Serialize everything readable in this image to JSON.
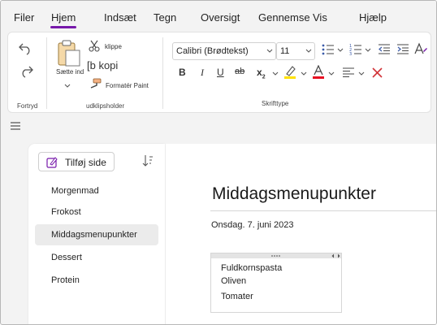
{
  "menu": {
    "items": [
      "Filer",
      "Hjem",
      "Indsæt",
      "Tegn",
      "Oversigt",
      "Gennemse",
      "Vis",
      "Hjælp"
    ],
    "active": "Hjem",
    "accent": "#7719aa"
  },
  "ribbon": {
    "undo_group": {
      "undo_icon": "undo-icon",
      "redo_icon": "redo-icon",
      "label": "Fortryd"
    },
    "clipboard": {
      "paste_label": "Sætte ind",
      "cut_label": "klippe",
      "copy_label": "[b kopi",
      "format_painter_label": "Formatér Paint",
      "label": "udklipsholder"
    },
    "font": {
      "font_name": "Calibri (Brødtekst)",
      "font_size": "11",
      "label": "Skrifttype",
      "highlight_color": "#ffe100",
      "font_color": "#e81123",
      "clear_color": "#d13438"
    }
  },
  "pages_pane": {
    "add_page_label": "Tilføj side",
    "pages": [
      "Morgenmad",
      "Frokost",
      "Middagsmenupunkter",
      "Dessert",
      "Protein"
    ],
    "selected_index": 2
  },
  "page": {
    "title": "Middagsmenupunkter",
    "date": "Onsdag. 7. juni 2023",
    "note_lines": [
      "Fuldkornspasta",
      "Oliven",
      "Tomater"
    ]
  }
}
